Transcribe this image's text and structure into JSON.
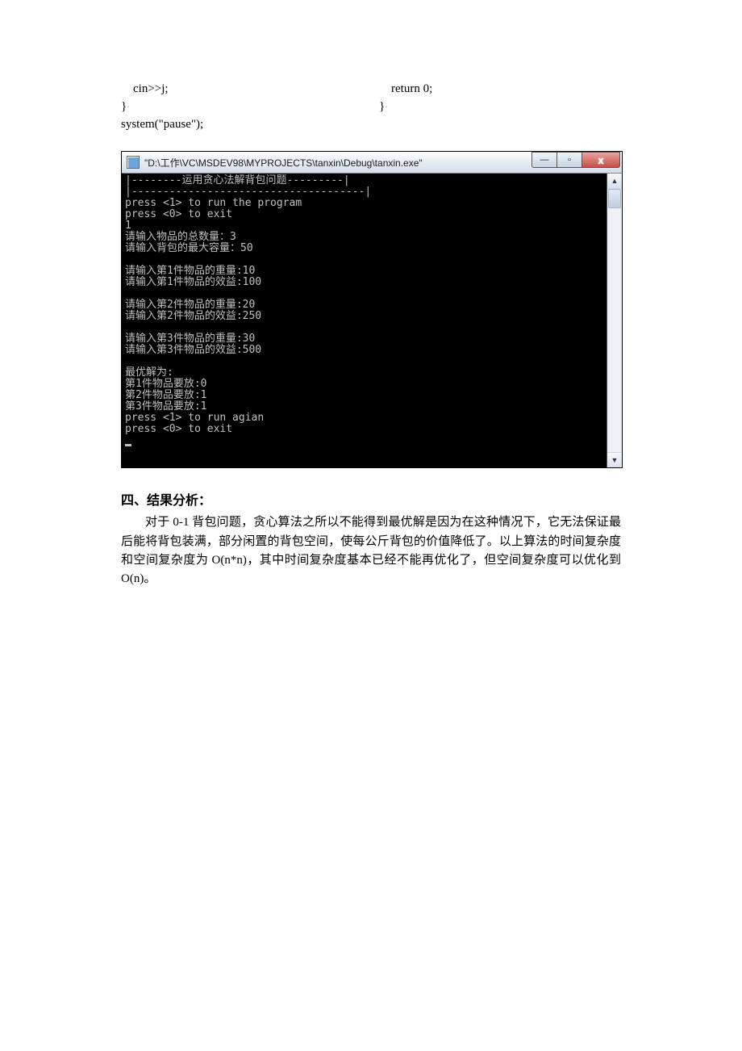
{
  "code": {
    "left": "    cin>>j;\n}\nsystem(\"pause\");",
    "right": "    return 0;\n}"
  },
  "console_window": {
    "title": "\"D:\\工作\\VC\\MSDEV98\\MYPROJECTS\\tanxin\\Debug\\tanxin.exe\"",
    "scroll_up": "▲",
    "scroll_down": "▼",
    "btn_min": "—",
    "btn_max": "▫",
    "btn_close": "x",
    "lines": [
      "|--------运用贪心法解背包问题---------|",
      "|-------------------------------------|",
      "press <1> to run the program",
      "press <0> to exit",
      "1",
      "请输入物品的总数量：3",
      "请输入背包的最大容量：50",
      "",
      "请输入第1件物品的重量:10",
      "请输入第1件物品的效益:100",
      "",
      "请输入第2件物品的重量:20",
      "请输入第2件物品的效益:250",
      "",
      "请输入第3件物品的重量:30",
      "请输入第3件物品的效益:500",
      "",
      "最优解为:",
      "第1件物品要放:0",
      "第2件物品要放:1",
      "第3件物品要放:1",
      "press <1> to run agian",
      "press <0> to exit"
    ]
  },
  "analysis": {
    "heading": "四、结果分析：",
    "body": "对于 0-1 背包问题，贪心算法之所以不能得到最优解是因为在这种情况下，它无法保证最后能将背包装满，部分闲置的背包空间，使每公斤背包的价值降低了。以上算法的时间复杂度和空间复杂度为 O(n*n)，其中时间复杂度基本已经不能再优化了，但空间复杂度可以优化到 O(n)。"
  }
}
